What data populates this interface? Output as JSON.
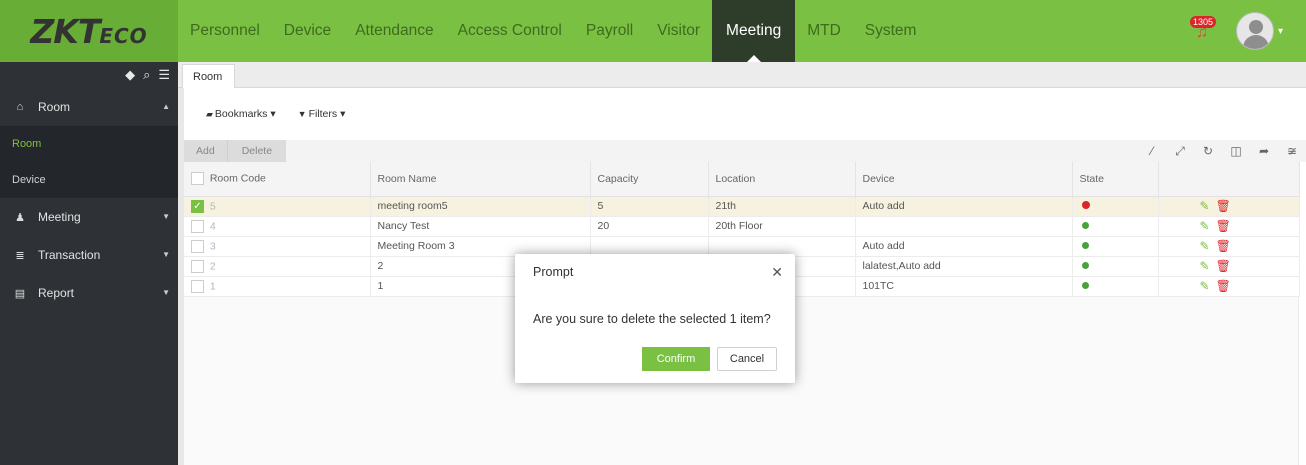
{
  "header": {
    "logo_main": "ZKT",
    "logo_sub": "ECO",
    "nav": [
      "Personnel",
      "Device",
      "Attendance",
      "Access Control",
      "Payroll",
      "Visitor",
      "Meeting",
      "MTD",
      "System"
    ],
    "active_nav": "Meeting",
    "notification_count": "1305"
  },
  "sidebar": {
    "groups": [
      {
        "label": "Room",
        "icon": "home-icon",
        "expanded": true,
        "items": [
          {
            "label": "Room",
            "active": true
          },
          {
            "label": "Device",
            "active": false
          }
        ]
      },
      {
        "label": "Meeting",
        "icon": "users-icon",
        "expanded": false
      },
      {
        "label": "Transaction",
        "icon": "database-icon",
        "expanded": false
      },
      {
        "label": "Report",
        "icon": "report-icon",
        "expanded": false
      }
    ]
  },
  "main": {
    "tab": "Room",
    "bookmarks": "Bookmarks",
    "filters": "Filters",
    "add_label": "Add",
    "delete_label": "Delete",
    "columns": [
      "Room Code",
      "Room Name",
      "Capacity",
      "Location",
      "Device",
      "State"
    ],
    "rows": [
      {
        "checked": true,
        "code": "5",
        "name": "meeting room5",
        "capacity": "5",
        "location": "21th",
        "device": "Auto add",
        "state": "error"
      },
      {
        "checked": false,
        "code": "4",
        "name": "Nancy Test",
        "capacity": "20",
        "location": "20th Floor",
        "device": "",
        "state": "ok"
      },
      {
        "checked": false,
        "code": "3",
        "name": "Meeting Room 3",
        "capacity": "",
        "location": "",
        "device": "Auto add",
        "state": "ok"
      },
      {
        "checked": false,
        "code": "2",
        "name": "2",
        "capacity": "",
        "location": "",
        "device": "lalatest,Auto add",
        "state": "ok"
      },
      {
        "checked": false,
        "code": "1",
        "name": "1",
        "capacity": "",
        "location": "",
        "device": "101TC",
        "state": "ok"
      }
    ]
  },
  "modal": {
    "title": "Prompt",
    "message": "Are you sure to delete the selected 1 item?",
    "confirm_label": "Confirm",
    "cancel_label": "Cancel"
  },
  "colors": {
    "brand_green": "#7ac143",
    "sidebar_bg": "#2e3135",
    "danger": "#d9262a"
  }
}
